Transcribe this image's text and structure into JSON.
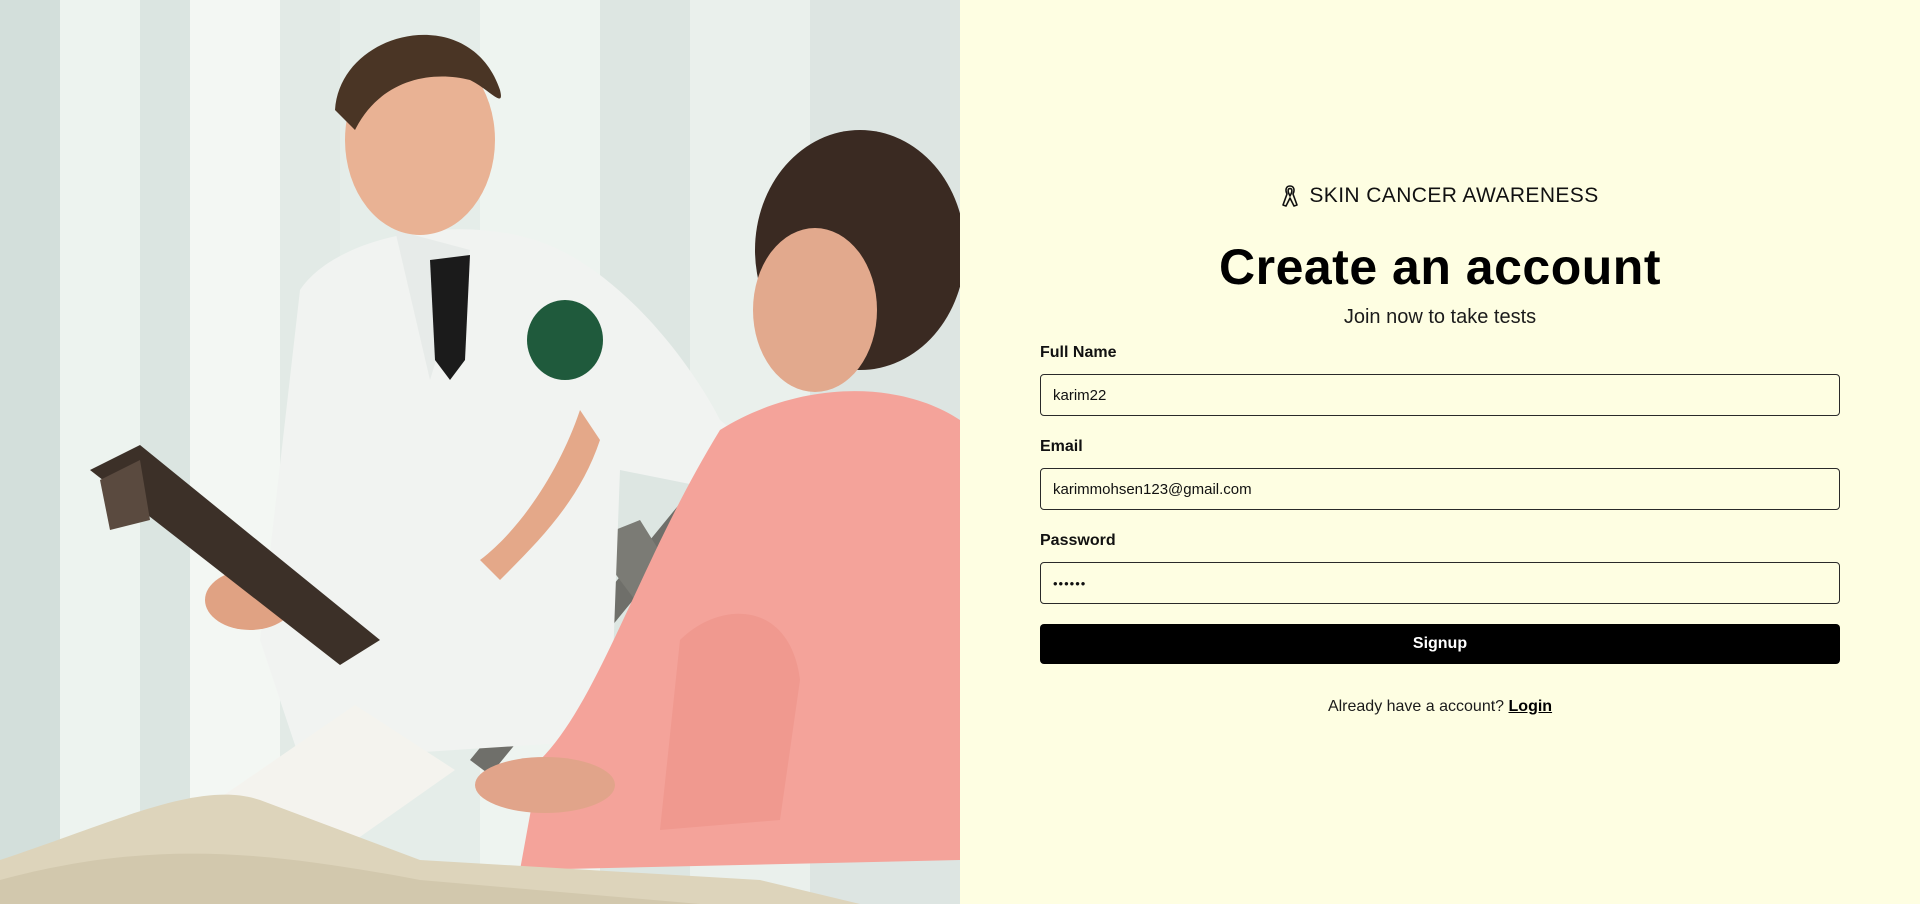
{
  "hero": {
    "image_description_icon": "doctor-patient-photo"
  },
  "brand": {
    "icon": "awareness-ribbon-icon",
    "name": "SKIN CANCER AWARENESS"
  },
  "header": {
    "title": "Create an account",
    "subtitle": "Join now to take tests"
  },
  "form": {
    "full_name": {
      "label": "Full Name",
      "value": "karim22"
    },
    "email": {
      "label": "Email",
      "value": "karimmohsen123@gmail.com"
    },
    "password": {
      "label": "Password",
      "value": "••••••"
    },
    "submit_label": "Signup"
  },
  "footer": {
    "prompt": "Already have a account?",
    "login_label": "Login"
  },
  "colors": {
    "background": "#fefee2",
    "button": "#000000",
    "button_text": "#ffffff"
  }
}
